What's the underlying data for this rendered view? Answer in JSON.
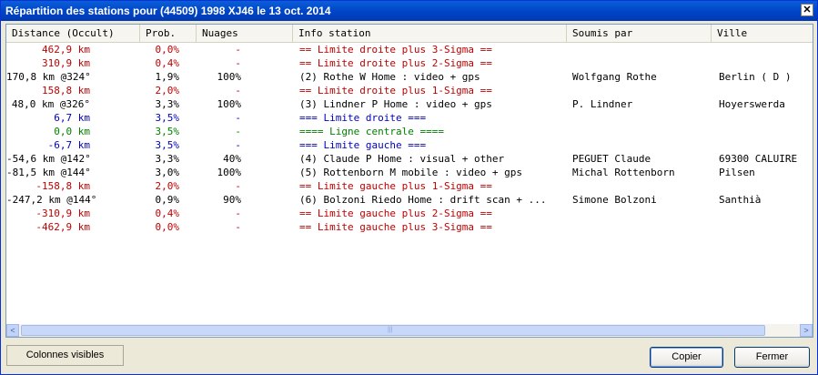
{
  "window": {
    "title": "Répartition des stations pour (44509) 1998 XJ46 le 13 oct. 2014",
    "close_glyph": "✕"
  },
  "columns": {
    "distance": "Distance (Occult)",
    "prob": "Prob.",
    "nuages": "Nuages",
    "info": "Info station",
    "soumis": "Soumis par",
    "ville": "Ville"
  },
  "colors": {
    "red": "#c00000",
    "black": "#000000",
    "blue": "#0000c0",
    "green": "#008000"
  },
  "rows": [
    {
      "dist": "462,9 km",
      "prob": "0,0%",
      "nuages": "-",
      "info": "== Limite droite plus 3-Sigma ==",
      "soumis": "",
      "ville": "",
      "color": "red"
    },
    {
      "dist": "310,9 km",
      "prob": "0,4%",
      "nuages": "-",
      "info": "== Limite droite plus 2-Sigma ==",
      "soumis": "",
      "ville": "",
      "color": "red"
    },
    {
      "dist": "170,8 km @324°",
      "prob": "1,9%",
      "nuages": "100%",
      "info": "(2) Rothe W Home : video + gps",
      "soumis": "Wolfgang Rothe",
      "ville": "Berlin ( D )",
      "color": "black"
    },
    {
      "dist": "158,8 km",
      "prob": "2,0%",
      "nuages": "-",
      "info": "== Limite droite plus 1-Sigma ==",
      "soumis": "",
      "ville": "",
      "color": "red"
    },
    {
      "dist": "48,0 km @326°",
      "prob": "3,3%",
      "nuages": "100%",
      "info": "(3) Lindner P Home : video + gps",
      "soumis": "P. Lindner",
      "ville": "Hoyerswerda",
      "color": "black"
    },
    {
      "dist": "6,7 km",
      "prob": "3,5%",
      "nuages": "-",
      "info": "===  Limite droite  ===",
      "soumis": "",
      "ville": "",
      "color": "blue"
    },
    {
      "dist": "0,0 km",
      "prob": "3,5%",
      "nuages": "-",
      "info": "==== Ligne centrale    ====",
      "soumis": "",
      "ville": "",
      "color": "green"
    },
    {
      "dist": "-6,7 km",
      "prob": "3,5%",
      "nuages": "-",
      "info": "===  Limite gauche  ===",
      "soumis": "",
      "ville": "",
      "color": "blue"
    },
    {
      "dist": "-54,6 km @142°",
      "prob": "3,3%",
      "nuages": "40%",
      "info": "(4) Claude P Home : visual + other",
      "soumis": "PEGUET Claude",
      "ville": "69300 CALUIRE",
      "color": "black"
    },
    {
      "dist": "-81,5 km @144°",
      "prob": "3,0%",
      "nuages": "100%",
      "info": "(5) Rottenborn M mobile : video + gps",
      "soumis": "Michal Rottenborn",
      "ville": "Pilsen",
      "color": "black"
    },
    {
      "dist": "-158,8 km",
      "prob": "2,0%",
      "nuages": "-",
      "info": "== Limite gauche plus 1-Sigma ==",
      "soumis": "",
      "ville": "",
      "color": "red"
    },
    {
      "dist": "-247,2 km @144°",
      "prob": "0,9%",
      "nuages": "90%",
      "info": "(6) Bolzoni Riedo Home : drift scan + ...",
      "soumis": "Simone Bolzoni",
      "ville": "Santhià",
      "color": "black"
    },
    {
      "dist": "-310,9 km",
      "prob": "0,4%",
      "nuages": "-",
      "info": "== Limite gauche plus 2-Sigma ==",
      "soumis": "",
      "ville": "",
      "color": "red"
    },
    {
      "dist": "-462,9 km",
      "prob": "0,0%",
      "nuages": "-",
      "info": "== Limite gauche plus 3-Sigma ==",
      "soumis": "",
      "ville": "",
      "color": "red"
    }
  ],
  "scrollbar": {
    "left_glyph": "<",
    "right_glyph": ">",
    "grip_glyph": "|||"
  },
  "buttons": {
    "visible_columns": "Colonnes visibles",
    "copy": "Copier",
    "close": "Fermer"
  }
}
